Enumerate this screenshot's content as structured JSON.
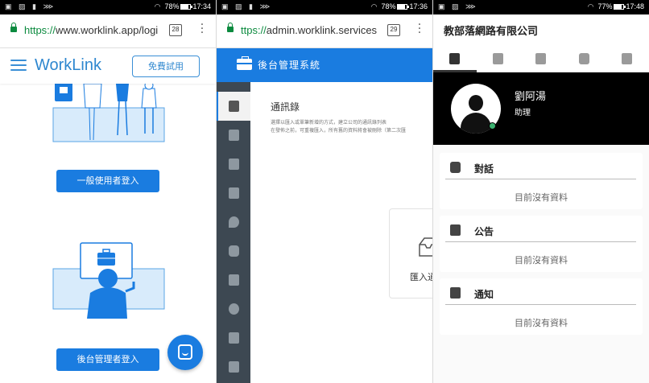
{
  "panels": [
    {
      "status": {
        "left_icons": "▣ ▨ ▮ ⋙",
        "battery": "78%",
        "time": "17:34"
      },
      "browser": {
        "url_scheme": "https://",
        "url_rest": "www.worklink.app/logi",
        "tab_count": "28"
      },
      "header": {
        "logo": "WorkLink",
        "trial_button": "免費試用"
      },
      "buttons": {
        "user_login": "一般使用者登入",
        "admin_login": "後台管理者登入"
      }
    },
    {
      "status": {
        "left_icons": "▣ ▨ ▮ ⋙",
        "battery": "78%",
        "time": "17:36"
      },
      "browser": {
        "url_scheme": "ttps://",
        "url_rest": "admin.worklink.services",
        "tab_count": "29"
      },
      "header": {
        "title": "後台管理系統"
      },
      "content": {
        "title": "通訊錄",
        "desc_line1": "選擇以匯入或單筆新增的方式，建立公司的通訊錄列表",
        "desc_line2": "在發佈之前，可重複匯入，所有舊的資料將會被刪除（第二次匯",
        "import_label": "匯入通"
      },
      "sidebar_icons": [
        "contacts-icon",
        "document-icon",
        "cloud-icon",
        "checklist-icon",
        "location-icon",
        "clock-icon",
        "building-icon",
        "gear-icon",
        "report-icon",
        "c-icon"
      ]
    },
    {
      "status": {
        "left_icons": "▣ ▨ ⋙",
        "battery": "77%",
        "time": "17:48"
      },
      "company": "教部落網路有限公司",
      "tabs": [
        "home-icon",
        "contacts-icon",
        "document-icon",
        "chat-icon",
        "apps-icon"
      ],
      "profile": {
        "name": "劉阿湯",
        "role": "助理"
      },
      "cards": [
        {
          "title": "對話",
          "empty": "目前沒有資料"
        },
        {
          "title": "公告",
          "empty": "目前沒有資料"
        },
        {
          "title": "通知",
          "empty": "目前沒有資料"
        }
      ]
    }
  ],
  "colors": {
    "brand_blue": "#1a7ce0",
    "sidebar_dark": "#3d4852",
    "secure_green": "#0b8a3e",
    "online_green": "#3cb371"
  }
}
